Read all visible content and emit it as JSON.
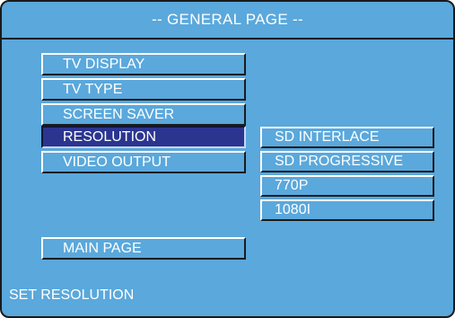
{
  "header": {
    "title": "-- GENERAL PAGE --"
  },
  "menu": {
    "items": [
      {
        "label": "TV DISPLAY",
        "selected": false
      },
      {
        "label": "TV TYPE",
        "selected": false
      },
      {
        "label": "SCREEN SAVER",
        "selected": false
      },
      {
        "label": "RESOLUTION",
        "selected": true
      },
      {
        "label": "VIDEO OUTPUT",
        "selected": false
      }
    ],
    "main_page_label": "MAIN PAGE"
  },
  "submenu": {
    "options": [
      {
        "label": "SD INTERLACE"
      },
      {
        "label": "SD PROGRESSIVE"
      },
      {
        "label": "770P"
      },
      {
        "label": "1080I"
      }
    ]
  },
  "status": {
    "text": "SET RESOLUTION"
  },
  "colors": {
    "background": "#5aa8dc",
    "selected": "#2b3590",
    "text": "#ffffff",
    "border_dark": "#1c1c1c"
  }
}
